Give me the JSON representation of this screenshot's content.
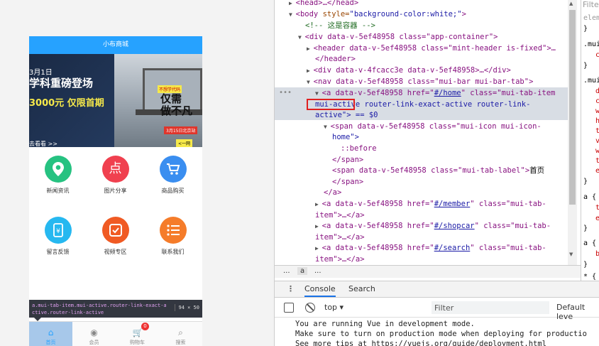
{
  "phone": {
    "header_title": "小布商城",
    "banner": {
      "date": "3月1日",
      "headline": "学科重磅登场",
      "price": "3000元 仅限首期",
      "more": "去看看 >>",
      "tag": "不想学代码",
      "big_text_1": "仅需",
      "big_text_2": "做不凡",
      "date2": "3月15日北京站",
      "btn": "<一网"
    },
    "grid": [
      {
        "label": "新闻资讯",
        "icon": "map-pin-icon",
        "color": "#26c281",
        "glyph": "⬤"
      },
      {
        "label": "图片分享",
        "icon": "image-share-icon",
        "color": "#f0404f",
        "glyph": "点"
      },
      {
        "label": "商品购买",
        "icon": "cart-icon",
        "color": "#3a8ef0",
        "glyph": "🛒"
      },
      {
        "label": "留言反馈",
        "icon": "feedback-icon",
        "color": "#26b8f0",
        "glyph": "¥"
      },
      {
        "label": "视频专区",
        "icon": "video-icon",
        "color": "#f05a23",
        "glyph": "✓"
      },
      {
        "label": "联系我们",
        "icon": "contact-icon",
        "color": "#f57c2a",
        "glyph": "☰"
      }
    ],
    "tooltip": {
      "selector_line1": "a.mui-tab-item.mui-active.router-link-exact-a",
      "selector_line2": "ctive.router-link-active",
      "size": "94 × 50"
    },
    "tabbar": [
      {
        "label": "首页",
        "icon": "home-icon",
        "active": true
      },
      {
        "label": "会员",
        "icon": "user-icon",
        "active": false
      },
      {
        "label": "购物车",
        "icon": "shopcart-icon",
        "active": false,
        "badge": "0"
      },
      {
        "label": "搜索",
        "icon": "search-icon",
        "active": false
      }
    ]
  },
  "devtools": {
    "elements": {
      "l1": "<head>…</head>",
      "l2_tag": "<body",
      "l2_attr": " style=",
      "l2_val": "\"background-color:white;\"",
      "l2_end": ">",
      "l3": "<!-- 这是容器 -->",
      "l4": "<div data-v-5ef48958 class=\"app-container\">",
      "l5": "<header data-v-5ef48958 class=\"mint-header is-fixed\">…",
      "l6": "</header>",
      "l7": "<div data-v-4fcacc3e data-v-5ef48958>…</div>",
      "l8": "<nav data-v-5ef48958 class=\"mui-bar mui-bar-tab\">",
      "l9a": "<a data-v-5ef48958 href=\"",
      "l9_href": "#/home",
      "l9b": "\" class=\"mui-tab-item",
      "l10_boxed": "mui-active",
      "l10_rest": " router-link-exact-active router-link-",
      "l11": "active\"> == $0",
      "l12": "<span data-v-5ef48958 class=\"mui-icon mui-icon-",
      "l13": "home\">",
      "l14": "::before",
      "l15": "</span>",
      "l16a": "<span data-v-5ef48958 class=\"mui-tab-label\">",
      "l16_text": "首页",
      "l17": "</span>",
      "l18": "</a>",
      "l19a": "<a data-v-5ef48958 href=\"",
      "l19_href": "#/member",
      "l19b": "\" class=\"mui-tab-",
      "l20": "item\">…</a>",
      "l21a": "<a data-v-5ef48958 href=\"",
      "l21_href": "#/shopcar",
      "l21b": "\" class=\"mui-tab-",
      "l22": "item\">…</a>",
      "l23a": "<a data-v-5ef48958 href=\"",
      "l23_href": "#/search",
      "l23b": "\" class=\"mui-tab-",
      "l24": "item\">…</a>"
    },
    "styles_pane": {
      "filter": "Filte",
      "lines": [
        "elem",
        "}",
        ".mui",
        "c",
        "}",
        ".mui",
        "d",
        "c",
        "w",
        "h",
        "t",
        "v",
        "w",
        "t",
        "e",
        "}",
        "a {",
        "t",
        "e",
        "}",
        "a {",
        "b",
        "}",
        "* {"
      ]
    },
    "breadcrumb": [
      "...",
      "a",
      "..."
    ],
    "console_tabs": [
      "Console",
      "Search"
    ],
    "context": "top",
    "filter_placeholder": "Filter",
    "levels": "Default leve",
    "console_lines": [
      "You are running Vue in development mode.",
      "Make sure to turn on production mode when deploying for productio",
      "See more tips at https://vuejs.org/guide/deployment.html"
    ]
  }
}
